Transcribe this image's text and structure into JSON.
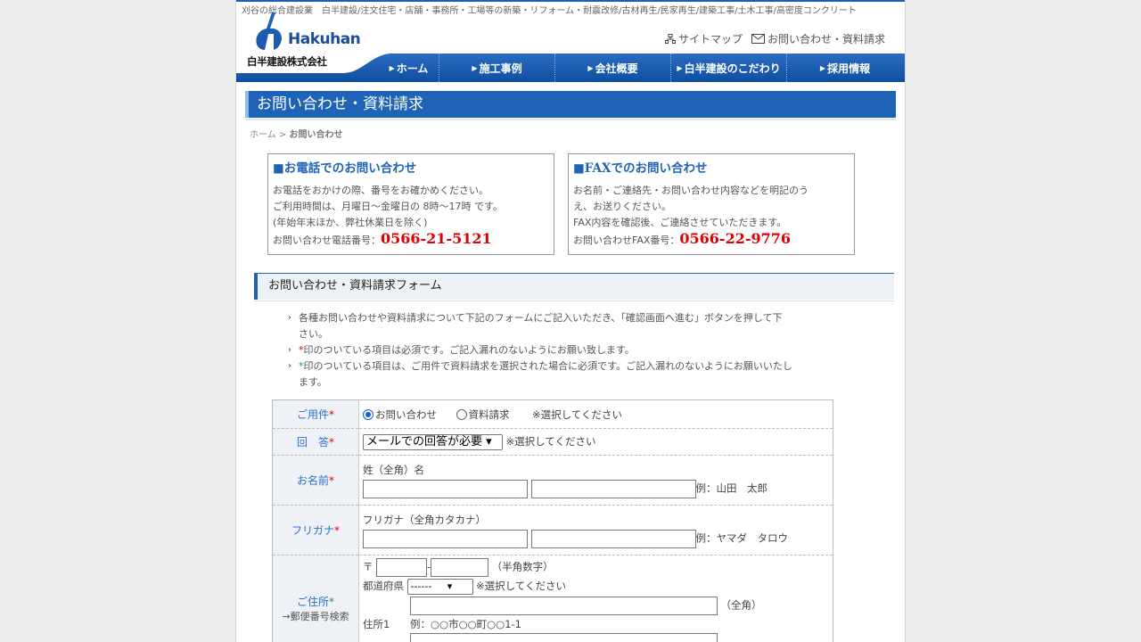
{
  "header": {
    "tagline": "刈谷の総合建設業　白半建設/注文住宅・店舗・事務所・工場等の新築・リフォーム・耐震改修/古材再生/民家再生/建築工事/土木工事/高密度コンクリート",
    "logo_word": "Hakuhan",
    "logo_company": "白半建設株式会社",
    "links": [
      {
        "label": "サイトマップ",
        "icon": "sitemap-icon"
      },
      {
        "label": "お問い合わせ・資料請求",
        "icon": "mail-icon"
      }
    ],
    "nav": [
      "ホーム",
      "施工事例",
      "会社概要",
      "白半建設のこだわり",
      "採用情報"
    ],
    "colors": {
      "brand": "#1f63b6",
      "nav_dark": "#0f4fa2"
    }
  },
  "page_title": "お問い合わせ・資料請求",
  "breadcrumb": {
    "home": "ホーム",
    "sep": " > ",
    "current": "お問い合わせ"
  },
  "tel_box": {
    "title": "■お電話でのお問い合わせ",
    "line1": "お電話をおかけの際、番号をお確かめください。",
    "line2": "ご利用時間は、月曜日～金曜日の 8時～17時 です。",
    "line3": "(年始年末ほか、弊社休業日を除く)",
    "label": "お問い合わせ電話番号：",
    "number": "0566-21-5121"
  },
  "fax_box": {
    "title": "■FAXでのお問い合わせ",
    "line1": "お名前・ご連絡先・お問い合わせ内容などを明記のう",
    "line2": "え、お送りください。",
    "line3": "FAX内容を確認後、ご連絡させていただきます。",
    "label": "お問い合わせFAX番号：",
    "number": "0566-22-9776"
  },
  "form_section": {
    "title": "お問い合わせ・資料請求フォーム",
    "note1a": "各種お問い合わせや資料請求について下記のフォームにご記入いただき、「確認画面へ進む」ボタンを押して下",
    "note1b": "さい。",
    "note2_mark": "*",
    "note2": "印のついている項目は必須です。ご記入漏れのないようにお願い致します。",
    "note3_mark": "*",
    "note3a": "印のついている項目は、ご用件で資料請求を選択された場合に必須です。ご記入漏れのないようにお願いいたし",
    "note3b": "ます。"
  },
  "form": {
    "req": "*",
    "youken": {
      "label": "ご用件",
      "opt1": "お問い合わせ",
      "opt2": "資料請求",
      "hint": "※選択してください"
    },
    "kaitou": {
      "label": "回　答",
      "selected": "メールでの回答が必要",
      "hint": "※選択してください"
    },
    "name": {
      "label": "お名前",
      "caption": "姓（全角）名",
      "example": "例：山田　太郎"
    },
    "furigana": {
      "label": "フリガナ",
      "caption": "フリガナ（全角カタカナ）",
      "example": "例：ヤマダ　タロウ"
    },
    "address": {
      "label": "ご住所",
      "sublabel": "→郵便番号検索",
      "zip_mark": "〒",
      "zip_dash": "-",
      "zip_hint": "（半角数字）",
      "pref_label": "都道府県",
      "pref_selected": "------",
      "pref_hint": "※選択してください",
      "full_hint": "（全角）",
      "addr1_label": "住所1",
      "addr1_example": "例：○○市○○町○○1-1"
    }
  }
}
